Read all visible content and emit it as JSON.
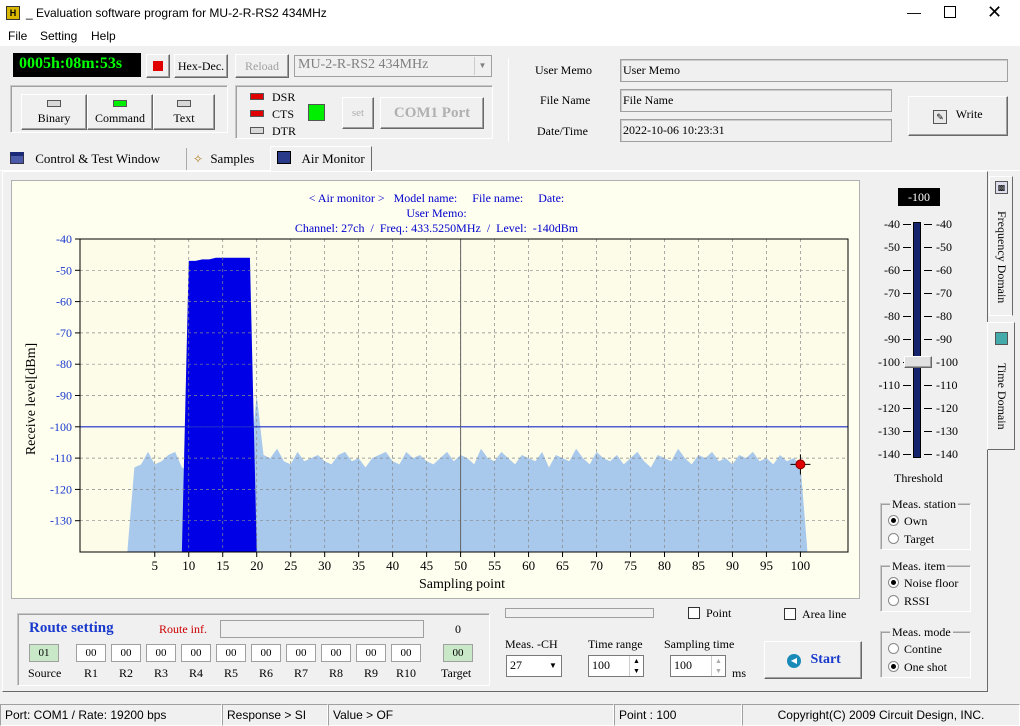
{
  "window": {
    "title": "_  Evaluation software program for MU-2-R-RS2  434MHz"
  },
  "menu": [
    "File",
    "Setting",
    "Help"
  ],
  "toolbar": {
    "timer": "0005h:08m:53s",
    "hexdec_label": "Hex-Dec.",
    "reload_label": "Reload",
    "model_select": "MU-2-R-RS2  434MHz",
    "modes": [
      "Binary",
      "Command",
      "Text"
    ],
    "signals": [
      "DSR",
      "CTS",
      "DTR"
    ],
    "set_label": "set",
    "com_label": "COM1 Port"
  },
  "info": {
    "memo_label": "User Memo",
    "memo_value": "User Memo",
    "file_label": "File Name",
    "file_value": "File Name",
    "date_label": "Date/Time",
    "date_value": "2022-10-06 10:23:31",
    "write_label": "Write"
  },
  "tabs": [
    "Control  & Test Window",
    "Samples",
    "Air Monitor"
  ],
  "chart_header": {
    "line1": "< Air monitor >   Model name:     File name:     Date:",
    "line2": "User Memo:",
    "line3": "Channel: 27ch  /  Freq.: 433.5250MHz  /  Level:  -140dBm"
  },
  "chart_data": {
    "type": "area",
    "xlabel": "Sampling point",
    "ylabel": "Receive level[dBm]",
    "xlim": [
      -6,
      107
    ],
    "ylim": [
      -140,
      -40
    ],
    "xticks": [
      5,
      10,
      15,
      20,
      25,
      30,
      35,
      40,
      45,
      50,
      55,
      60,
      65,
      70,
      75,
      80,
      85,
      90,
      95,
      100
    ],
    "yticks": [
      -40,
      -50,
      -60,
      -70,
      -80,
      -90,
      -100,
      -110,
      -120,
      -130
    ],
    "threshold": -100,
    "cursor_x": 50,
    "marker": {
      "x": 100,
      "y": -112
    },
    "noise_series": {
      "x": [
        1,
        2,
        3,
        4,
        5,
        6,
        7,
        8,
        9,
        10,
        11,
        12,
        13,
        14,
        15,
        16,
        17,
        18,
        19,
        20,
        21,
        22,
        23,
        24,
        25,
        26,
        27,
        28,
        29,
        30,
        31,
        32,
        33,
        34,
        35,
        36,
        37,
        38,
        39,
        40,
        41,
        42,
        43,
        44,
        45,
        46,
        47,
        48,
        49,
        50,
        51,
        52,
        53,
        54,
        55,
        56,
        57,
        58,
        59,
        60,
        61,
        62,
        63,
        64,
        65,
        66,
        67,
        68,
        69,
        70,
        71,
        72,
        73,
        74,
        75,
        76,
        77,
        78,
        79,
        80,
        81,
        82,
        83,
        84,
        85,
        86,
        87,
        88,
        89,
        90,
        91,
        92,
        93,
        94,
        95,
        96,
        97,
        98,
        99,
        100,
        101
      ],
      "values": [
        -139,
        -113,
        -112,
        -108,
        -112,
        -111,
        -109,
        -108,
        -113,
        -114,
        -113,
        -112,
        -113,
        -112,
        -112,
        -112,
        -112,
        -112,
        -112,
        -90,
        -109,
        -110,
        -107,
        -111,
        -112,
        -108,
        -111,
        -110,
        -109,
        -111,
        -112,
        -109,
        -108,
        -111,
        -110,
        -113,
        -110,
        -109,
        -108,
        -111,
        -112,
        -108,
        -110,
        -109,
        -111,
        -112,
        -110,
        -108,
        -111,
        -109,
        -110,
        -112,
        -107,
        -110,
        -111,
        -108,
        -110,
        -112,
        -109,
        -110,
        -111,
        -108,
        -113,
        -109,
        -110,
        -111,
        -107,
        -110,
        -112,
        -108,
        -110,
        -111,
        -109,
        -112,
        -110,
        -108,
        -111,
        -113,
        -109,
        -110,
        -111,
        -107,
        -110,
        -112,
        -109,
        -110,
        -108,
        -111,
        -110,
        -112,
        -109,
        -110,
        -108,
        -111,
        -110,
        -112,
        -109,
        -111,
        -110,
        -112,
        -139
      ]
    },
    "peak_series": {
      "x": [
        9,
        10,
        11,
        12,
        13,
        14,
        15,
        16,
        17,
        18,
        19,
        20
      ],
      "values": [
        -139,
        -47,
        -47,
        -46.5,
        -46.5,
        -46,
        -46,
        -46,
        -46,
        -46,
        -46,
        -139
      ]
    }
  },
  "slider": {
    "value": "-100",
    "ticks": [
      "-40",
      "-50",
      "-60",
      "-70",
      "-80",
      "-90",
      "-100",
      "-110",
      "-120",
      "-130",
      "-140"
    ],
    "level": -100,
    "label": "Threshold"
  },
  "side_tabs": [
    "Frequency Domain",
    "Time Domain"
  ],
  "meas_station": {
    "title": "Meas. station",
    "options": [
      "Own",
      "Target"
    ],
    "selected": 0
  },
  "meas_item": {
    "title": "Meas. item",
    "options": [
      "Noise floor",
      "RSSI"
    ],
    "selected": 0
  },
  "meas_mode": {
    "title": "Meas. mode",
    "options": [
      "Contine",
      "One shot"
    ],
    "selected": 1
  },
  "route": {
    "title": "Route setting",
    "inf_label": "Route inf.",
    "count": "0",
    "source_value": "01",
    "source_label": "Source",
    "repeaters": [
      {
        "label": "R1",
        "value": "00"
      },
      {
        "label": "R2",
        "value": "00"
      },
      {
        "label": "R3",
        "value": "00"
      },
      {
        "label": "R4",
        "value": "00"
      },
      {
        "label": "R5",
        "value": "00"
      },
      {
        "label": "R6",
        "value": "00"
      },
      {
        "label": "R7",
        "value": "00"
      },
      {
        "label": "R8",
        "value": "00"
      },
      {
        "label": "R9",
        "value": "00"
      },
      {
        "label": "R10",
        "value": "00"
      }
    ],
    "target_value": "00",
    "target_label": "Target"
  },
  "controls": {
    "point_label": "Point",
    "area_label": "Area line",
    "ch_label": "Meas. -CH",
    "ch_value": "27",
    "time_range_label": "Time range",
    "time_range_value": "100",
    "sampling_label": "Sampling time",
    "sampling_value": "100",
    "ms_label": "ms",
    "start_label": "Start"
  },
  "status": {
    "port": "Port: COM1 / Rate: 19200 bps",
    "response": "Response > SI",
    "value": "Value > OF",
    "point": "Point : 100",
    "copyright": "Copyright(C) 2009 Circuit Design, INC."
  },
  "colors": {
    "peak": "#0000e6",
    "noise": "#a8c8ec",
    "led_green": "#00ee00",
    "led_red": "#e00000",
    "timer_text": "#00ff00"
  }
}
